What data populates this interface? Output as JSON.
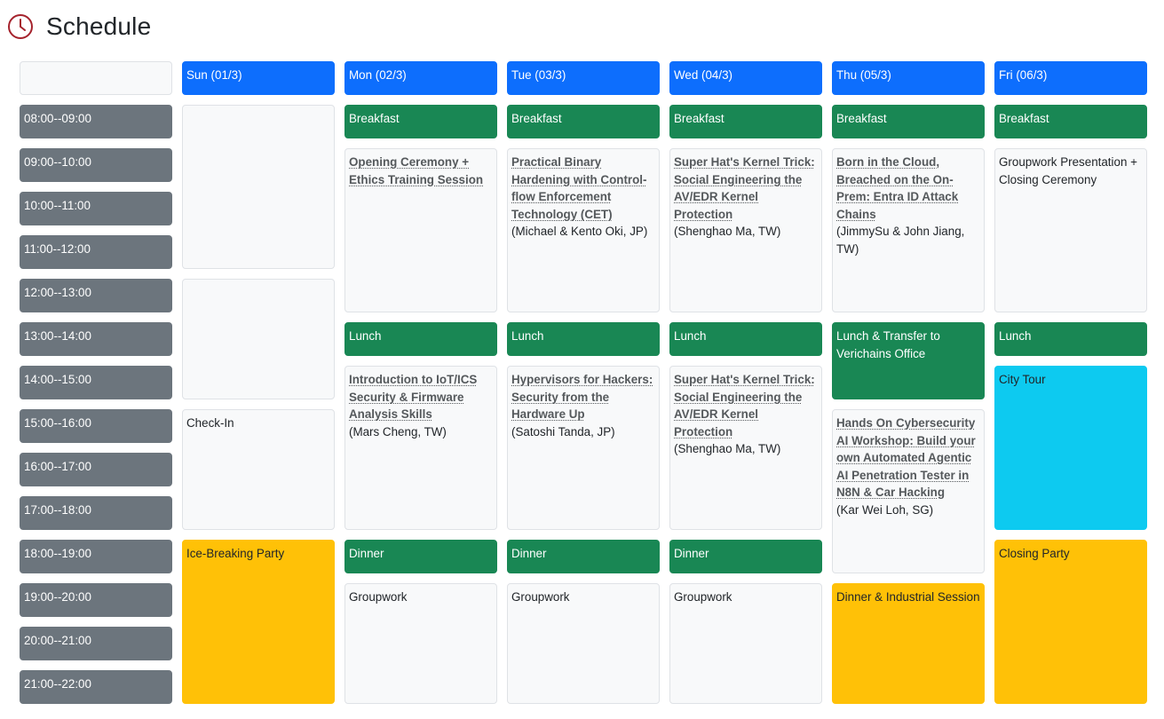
{
  "header": {
    "title": "Schedule",
    "icon": "clock-icon",
    "icon_color": "#a5232d"
  },
  "colors": {
    "day_header": "#0d6efd",
    "time_slot": "#6c757d",
    "meal": "#198754",
    "party": "#ffc107",
    "tour": "#0dcaf0",
    "session": "#f8f9fa"
  },
  "days": [
    "Sun (01/3)",
    "Mon (02/3)",
    "Tue (03/3)",
    "Wed (04/3)",
    "Thu (05/3)",
    "Fri (06/3)"
  ],
  "time_slots": [
    "08:00--09:00",
    "09:00--10:00",
    "10:00--11:00",
    "11:00--12:00",
    "12:00--13:00",
    "13:00--14:00",
    "14:00--15:00",
    "15:00--16:00",
    "16:00--17:00",
    "17:00--18:00",
    "18:00--19:00",
    "19:00--20:00",
    "20:00--21:00",
    "21:00--22:00"
  ],
  "events": {
    "sun_morning": {
      "title": ""
    },
    "sun_midday": {
      "title": ""
    },
    "sun_checkin": {
      "title": "Check-In"
    },
    "sun_party": {
      "title": "Ice-Breaking Party"
    },
    "mon_breakfast": {
      "title": "Breakfast"
    },
    "mon_opening": {
      "title": "Opening Ceremony + Ethics Training Session",
      "speaker": ""
    },
    "mon_lunch": {
      "title": "Lunch"
    },
    "mon_iot": {
      "title": "Introduction to IoT/ICS Security & Firmware Analysis Skills",
      "speaker": "(Mars Cheng, TW)"
    },
    "mon_dinner": {
      "title": "Dinner"
    },
    "mon_groupwork": {
      "title": "Groupwork"
    },
    "tue_breakfast": {
      "title": "Breakfast"
    },
    "tue_binary": {
      "title": "Practical Binary Hardening with Control-flow Enforcement Technology (CET)",
      "speaker": "(Michael & Kento Oki, JP)"
    },
    "tue_lunch": {
      "title": "Lunch"
    },
    "tue_hypervisors": {
      "title": "Hypervisors for Hackers: Security from the Hardware Up",
      "speaker": "(Satoshi Tanda, JP)"
    },
    "tue_dinner": {
      "title": "Dinner"
    },
    "tue_groupwork": {
      "title": "Groupwork"
    },
    "wed_breakfast": {
      "title": "Breakfast"
    },
    "wed_kernel_am": {
      "title": "Super Hat's Kernel Trick: Social Engineering the AV/EDR Kernel Protection",
      "speaker": "(Shenghao Ma, TW)"
    },
    "wed_lunch": {
      "title": "Lunch"
    },
    "wed_kernel_pm": {
      "title": "Super Hat's Kernel Trick: Social Engineering the AV/EDR Kernel Protection",
      "speaker": "(Shenghao Ma, TW)"
    },
    "wed_dinner": {
      "title": "Dinner"
    },
    "wed_groupwork": {
      "title": "Groupwork"
    },
    "thu_breakfast": {
      "title": "Breakfast"
    },
    "thu_cloud": {
      "title": "Born in the Cloud, Breached on the On-Prem: Entra ID Attack Chains",
      "speaker": "(JimmySu & John Jiang, TW)"
    },
    "thu_lunch": {
      "title": "Lunch & Transfer to Verichains Office"
    },
    "thu_workshop": {
      "title": "Hands On Cybersecurity AI Workshop: Build your own Automated Agentic AI Penetration Tester in N8N & Car Hacking",
      "speaker": "(Kar Wei Loh, SG)"
    },
    "thu_dinner": {
      "title": "Dinner & Industrial Session"
    },
    "fri_breakfast": {
      "title": "Breakfast"
    },
    "fri_closing_ceremony": {
      "title": "Groupwork Presentation + Closing Ceremony"
    },
    "fri_lunch": {
      "title": "Lunch"
    },
    "fri_city_tour": {
      "title": "City Tour"
    },
    "fri_closing_party": {
      "title": "Closing Party"
    }
  }
}
